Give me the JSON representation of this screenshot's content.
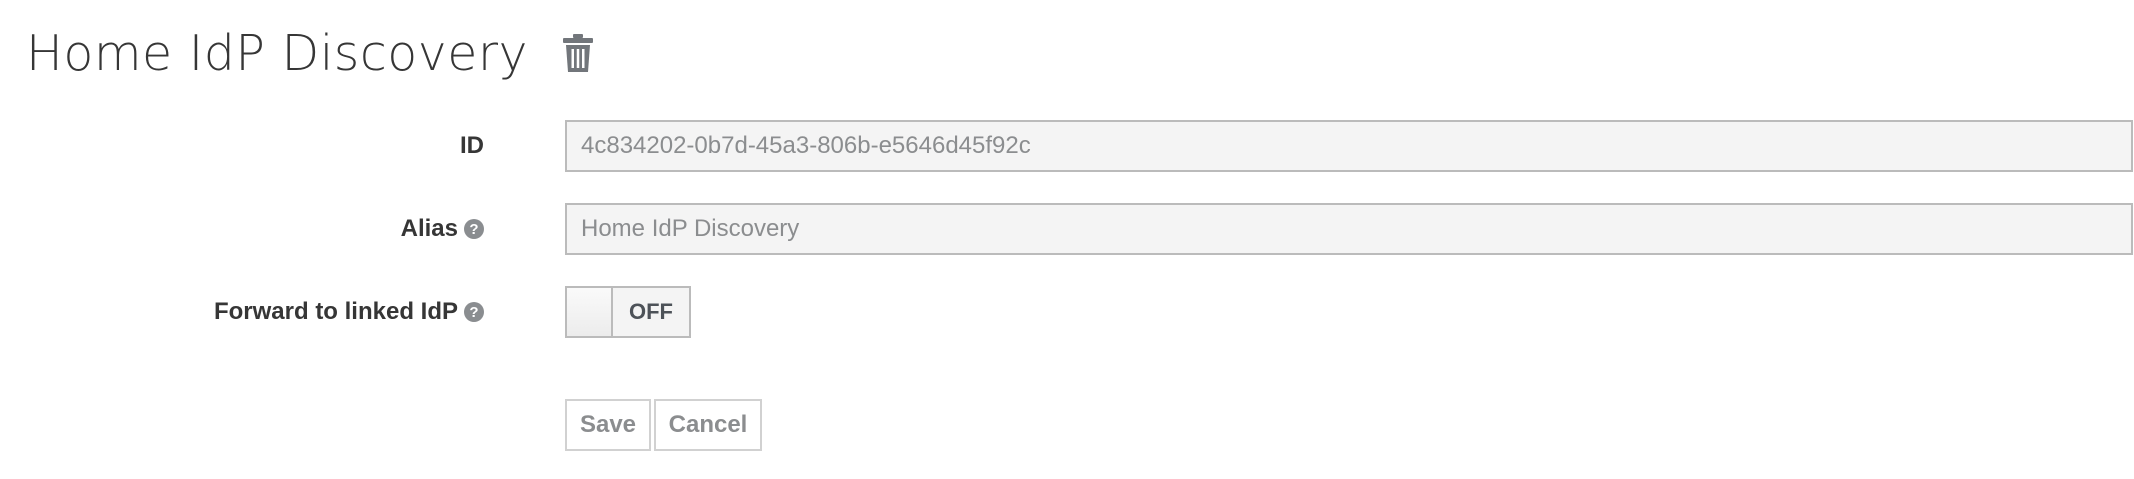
{
  "page": {
    "title": "Home IdP Discovery",
    "delete_icon": "trash-icon"
  },
  "form": {
    "id": {
      "label": "ID",
      "value": "4c834202-0b7d-45a3-806b-e5646d45f92c"
    },
    "alias": {
      "label": "Alias",
      "help_icon": "question-circle-icon",
      "value": "Home IdP Discovery"
    },
    "forward": {
      "label": "Forward to linked IdP",
      "help_icon": "question-circle-icon",
      "toggle_text": "OFF",
      "toggle_state": false
    },
    "actions": {
      "save_label": "Save",
      "cancel_label": "Cancel"
    }
  },
  "colors": {
    "text": "#363636",
    "field_bg": "#f4f4f4",
    "field_border": "#bbbbbb",
    "muted_text": "#8b8d8f",
    "help_icon": "#8a8d90"
  }
}
